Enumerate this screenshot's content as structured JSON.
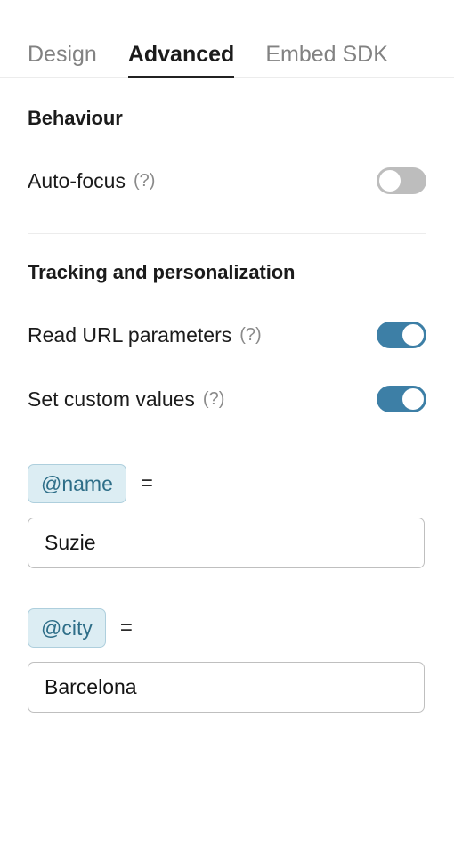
{
  "tabs": [
    {
      "label": "Design",
      "active": false
    },
    {
      "label": "Advanced",
      "active": true
    },
    {
      "label": "Embed SDK",
      "active": false
    }
  ],
  "behaviour": {
    "title": "Behaviour",
    "settings": [
      {
        "label": "Auto-focus",
        "help": "(?)",
        "enabled": false
      }
    ]
  },
  "tracking": {
    "title": "Tracking and personalization",
    "settings": [
      {
        "label": "Read URL parameters",
        "help": "(?)",
        "enabled": true
      },
      {
        "label": "Set custom values",
        "help": "(?)",
        "enabled": true
      }
    ],
    "custom_values": [
      {
        "variable": "@name",
        "equals": "=",
        "value": "Suzie",
        "placeholder": ""
      },
      {
        "variable": "@city",
        "equals": "=",
        "value": "Barcelona",
        "placeholder": ""
      }
    ]
  },
  "colors": {
    "toggle_on": "#3d7fa6",
    "toggle_off": "#bdbdbd",
    "chip_bg": "#dcedf3",
    "chip_border": "#aecfdd",
    "chip_text": "#2e6e88",
    "active_tab": "#1b1b1b",
    "inactive_tab": "#828282",
    "divider": "#ececec"
  }
}
